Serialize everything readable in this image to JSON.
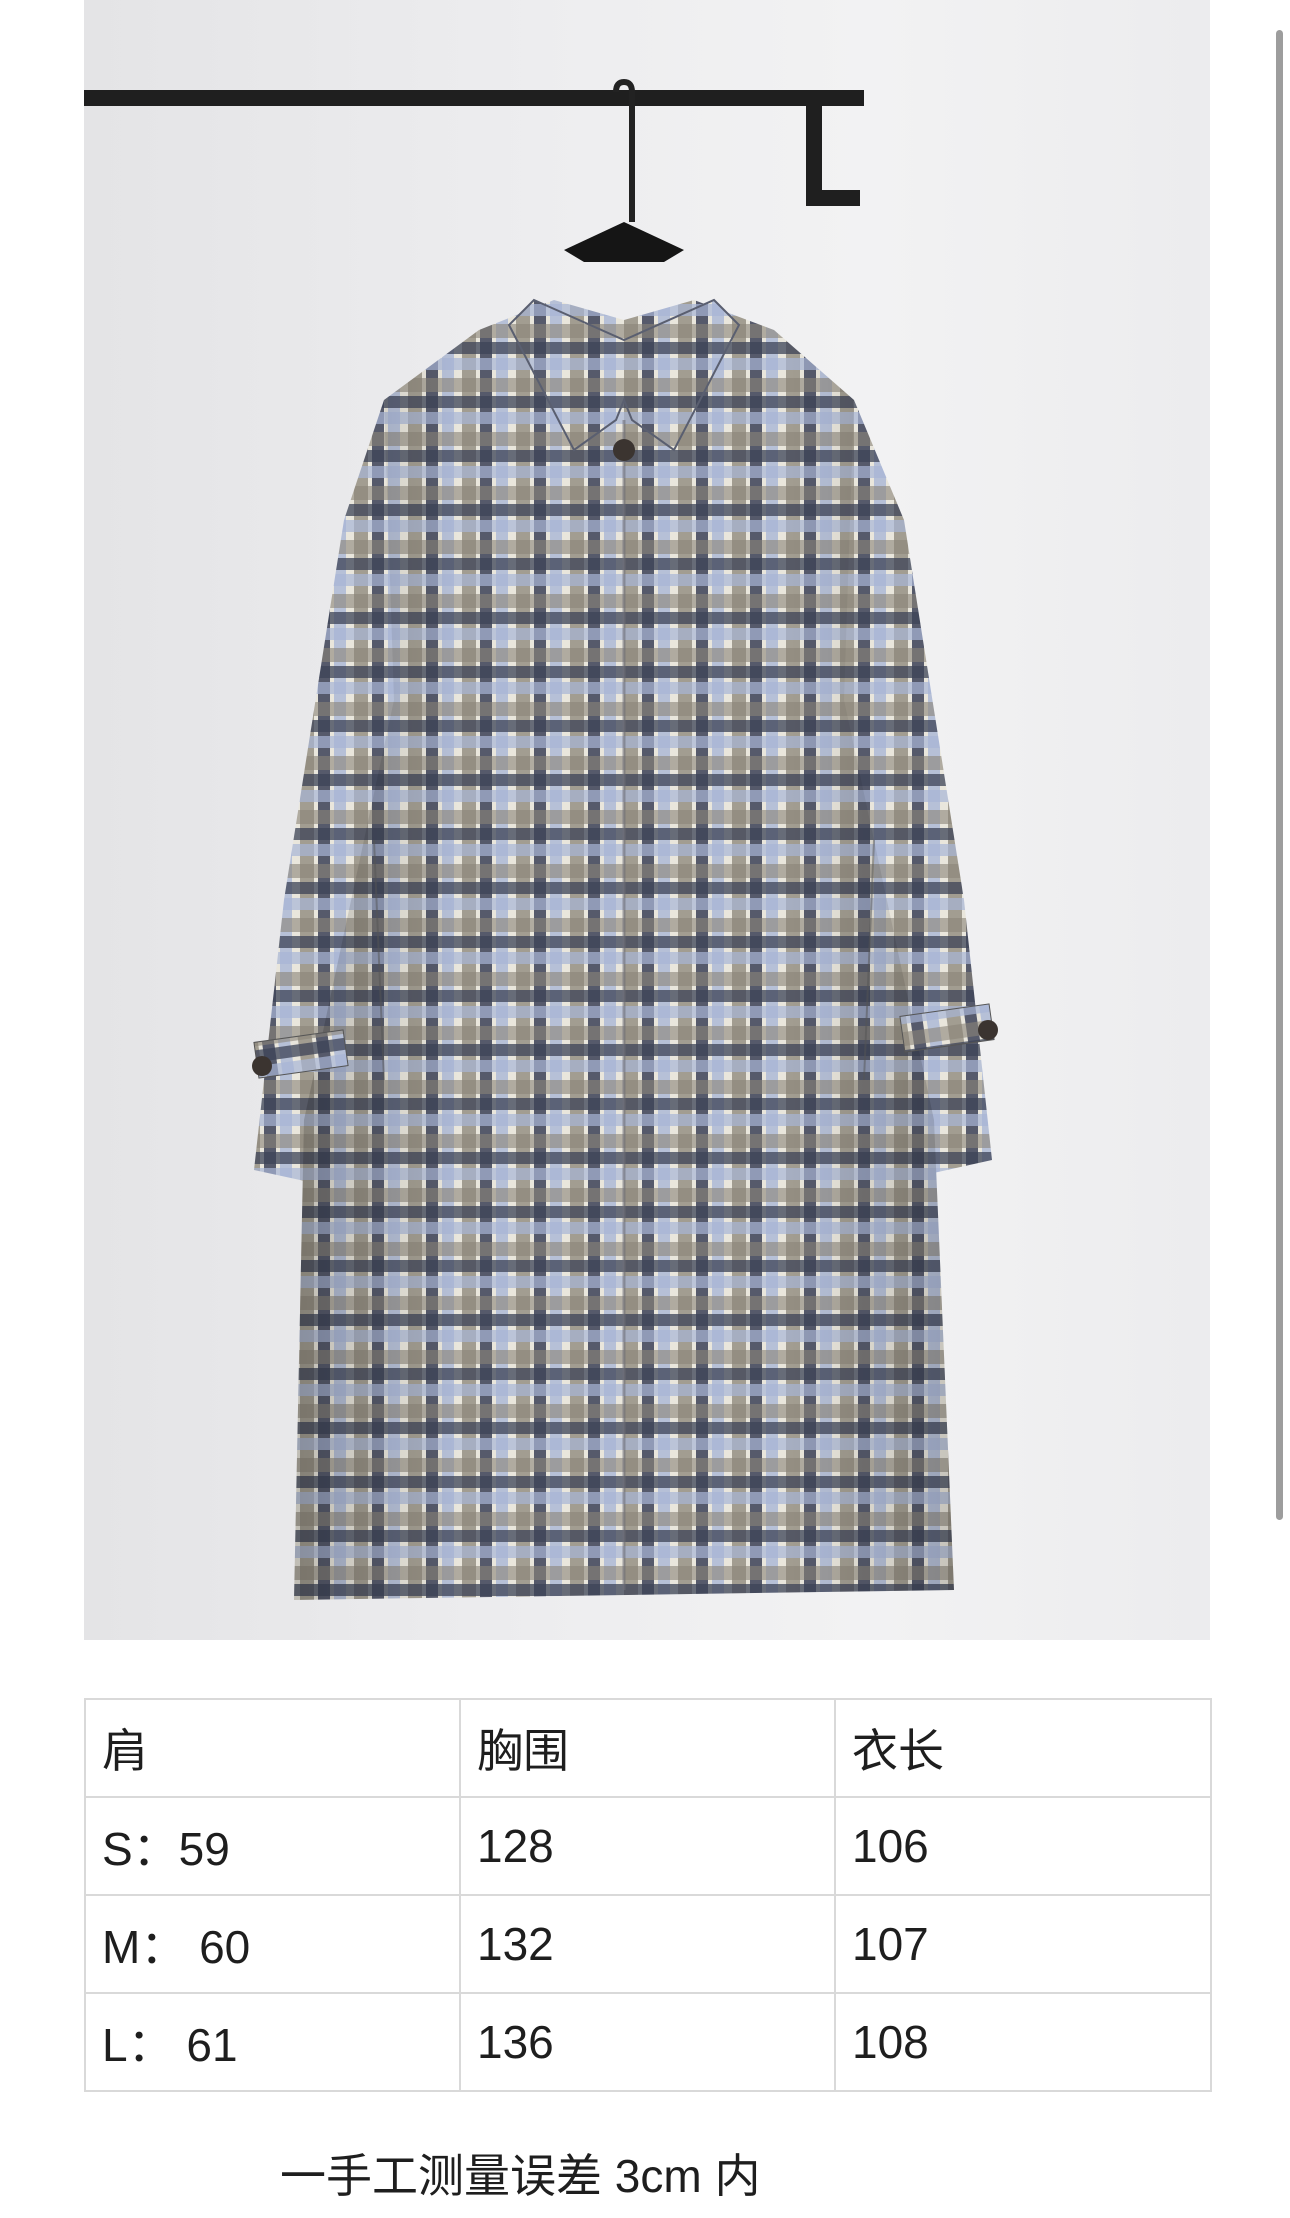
{
  "product_photo": {
    "subject": "plaid-long-coat"
  },
  "size_table": {
    "header": [
      "肩",
      "胸围",
      "衣长"
    ],
    "rows": [
      [
        "S：59",
        "128",
        "106"
      ],
      [
        "M：  60",
        "132",
        "107"
      ],
      [
        "L：  61",
        "136",
        "108"
      ]
    ]
  },
  "footnote": "一手工测量误差 3cm 内",
  "colors": {
    "plaid_navy": "#3c4257",
    "plaid_blue": "#a9b6d6",
    "plaid_taupe": "#8c8478",
    "plaid_cream": "#ebe8dc",
    "background": "#ffffff",
    "grid_line": "#d9d9d9"
  }
}
